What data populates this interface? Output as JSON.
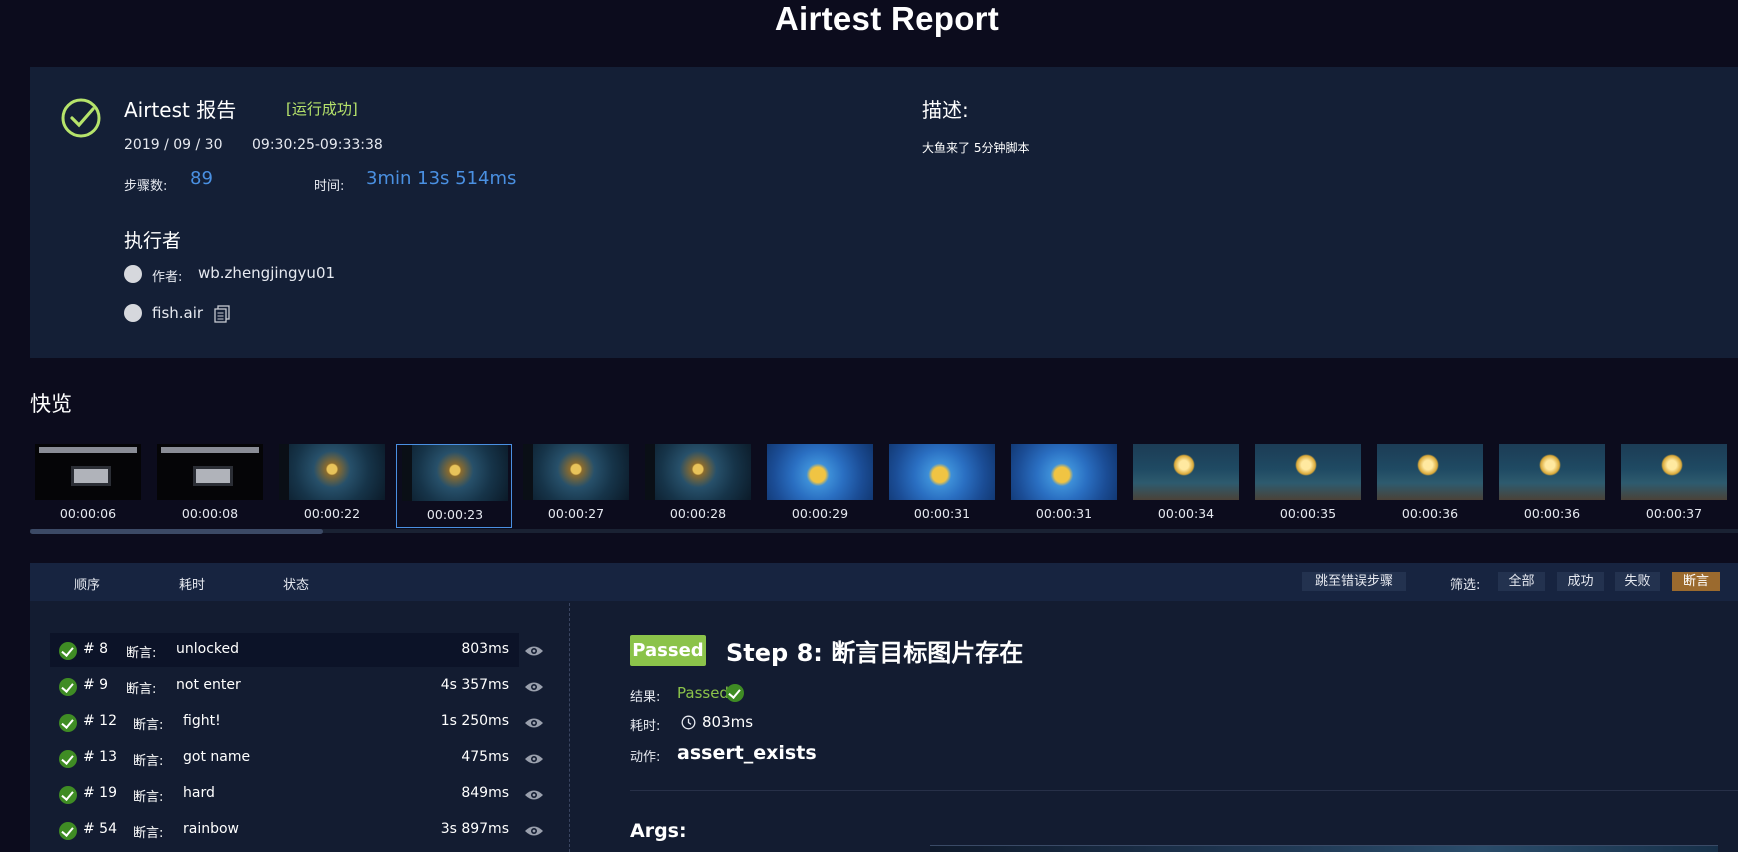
{
  "page_title": "Airtest Report",
  "summary": {
    "report_name": "Airtest 报告",
    "status": "[运行成功]",
    "date": "2019 / 09 / 30",
    "time_range": "09:30:25-09:33:38",
    "steps_label": "步骤数:",
    "steps_value": "89",
    "duration_label": "时间:",
    "duration_value": "3min 13s 514ms",
    "executor_heading": "执行者",
    "author_label": "作者:",
    "author_value": "wb.zhengjingyu01",
    "script_name": "fish.air",
    "description_heading": "描述:",
    "description_text": "大鱼来了 5分钟脚本",
    "icons": {
      "status": "check-circle-icon",
      "copy": "copy-icon"
    }
  },
  "quick_view": {
    "title": "快览",
    "thumbnails": [
      {
        "time": "00:00:06",
        "style": "black"
      },
      {
        "time": "00:00:08",
        "style": "black"
      },
      {
        "time": "00:00:22",
        "style": "dark"
      },
      {
        "time": "00:00:23",
        "style": "dark",
        "selected": true
      },
      {
        "time": "00:00:27",
        "style": "dark"
      },
      {
        "time": "00:00:28",
        "style": "dark"
      },
      {
        "time": "00:00:29",
        "style": "blue"
      },
      {
        "time": "00:00:31",
        "style": "blue"
      },
      {
        "time": "00:00:31",
        "style": "blue"
      },
      {
        "time": "00:00:34",
        "style": "reef"
      },
      {
        "time": "00:00:35",
        "style": "reef"
      },
      {
        "time": "00:00:36",
        "style": "reef"
      },
      {
        "time": "00:00:36",
        "style": "reef"
      },
      {
        "time": "00:00:37",
        "style": "reef"
      }
    ]
  },
  "steps_header": {
    "tabs": [
      "顺序",
      "耗时",
      "状态"
    ],
    "jump_label": "跳至错误步骤",
    "filter_label": "筛选:",
    "filters": [
      {
        "label": "全部",
        "active": false
      },
      {
        "label": "成功",
        "active": false
      },
      {
        "label": "失败",
        "active": false
      },
      {
        "label": "断言",
        "active": true
      }
    ]
  },
  "steps": [
    {
      "num": "# 8",
      "kind": "断言:",
      "text": "unlocked",
      "duration": "803ms",
      "active": true
    },
    {
      "num": "# 9",
      "kind": "断言:",
      "text": "not enter",
      "duration": "4s 357ms"
    },
    {
      "num": "# 12",
      "kind": "断言:",
      "text": "fight!",
      "duration": "1s 250ms"
    },
    {
      "num": "# 13",
      "kind": "断言:",
      "text": "got name",
      "duration": "475ms"
    },
    {
      "num": "# 19",
      "kind": "断言:",
      "text": "hard",
      "duration": "849ms"
    },
    {
      "num": "# 54",
      "kind": "断言:",
      "text": "rainbow",
      "duration": "3s 897ms"
    }
  ],
  "detail": {
    "badge": "Passed",
    "title": "Step 8: 断言目标图片存在",
    "result_label": "结果:",
    "result_value": "Passed",
    "elapsed_label": "耗时:",
    "elapsed_value": "803ms",
    "action_label": "动作:",
    "action_value": "assert_exists",
    "args_heading": "Args:"
  },
  "colors": {
    "background": "#0c0c1d",
    "panel": "#141f36",
    "accent_blue": "#4a90e2",
    "success_green": "#8bc34a",
    "status_text": "#b6e36b",
    "assert_active": "#9b6a2e"
  }
}
